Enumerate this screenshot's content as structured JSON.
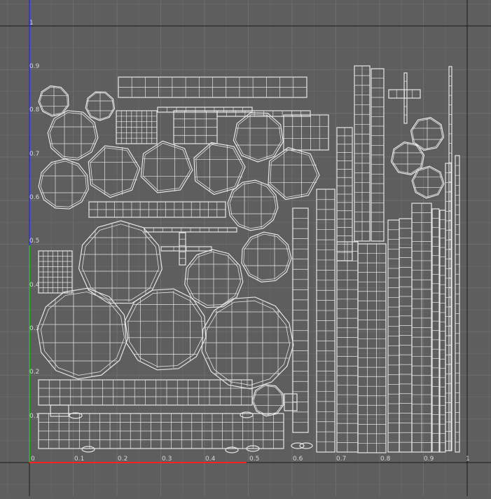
{
  "editor": {
    "view": "UV texture editor",
    "background_color": "#5e5e5e",
    "grid_color": "#6d6d6d",
    "border_color": "#1a1a1a",
    "v_axis_color": "#1c1cff",
    "u_axis_color": "#ff2020",
    "wire_color": "#e6e6e6",
    "label_color": "#d8d8d8"
  },
  "axes": {
    "origin_label": "0",
    "u_labels": [
      "0.1",
      "0.2",
      "0.3",
      "0.4",
      "0.5",
      "0.6",
      "0.7",
      "0.8",
      "0.9",
      "1"
    ],
    "v_labels": [
      "0.1",
      "0.2",
      "0.3",
      "0.4",
      "0.5",
      "0.6",
      "0.7",
      "0.8",
      "0.9",
      "1"
    ]
  }
}
